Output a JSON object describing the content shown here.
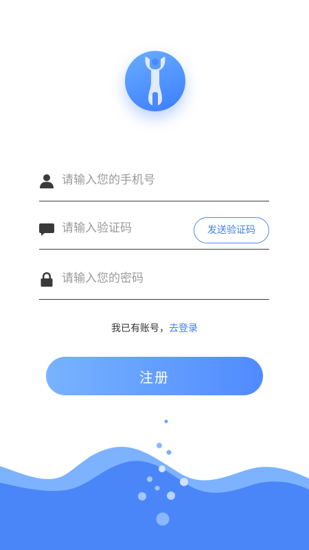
{
  "fields": {
    "phone": {
      "placeholder": "请输入您的手机号",
      "value": ""
    },
    "code": {
      "placeholder": "请输入验证码",
      "value": "",
      "send_button": "发送验证码"
    },
    "password": {
      "placeholder": "请输入您的密码",
      "value": ""
    }
  },
  "login_prompt": {
    "text": "我已有账号，",
    "link": "去登录"
  },
  "register_button": "注册",
  "colors": {
    "accent": "#4a86f7",
    "button_gradient_start": "#78b3ff",
    "button_gradient_end": "#4f8bff",
    "wave_light": "#6aa9ff",
    "wave_dark": "#4a86f7"
  },
  "icons": {
    "logo": "wrench-icon",
    "phone": "user-icon",
    "code": "message-icon",
    "password": "lock-icon"
  }
}
